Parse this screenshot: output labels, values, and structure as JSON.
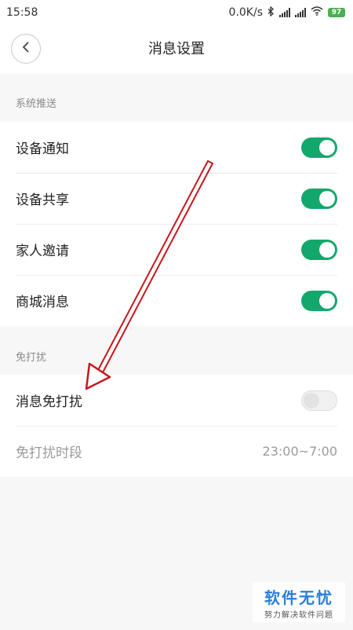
{
  "status_bar": {
    "time": "15:58",
    "speed": "0.0K/s",
    "battery": "97"
  },
  "header": {
    "title": "消息设置"
  },
  "sections": [
    {
      "title": "系统推送",
      "items": [
        {
          "label": "设备通知",
          "toggle": "on"
        },
        {
          "label": "设备共享",
          "toggle": "on"
        },
        {
          "label": "家人邀请",
          "toggle": "on"
        },
        {
          "label": "商城消息",
          "toggle": "on"
        }
      ]
    },
    {
      "title": "免打扰",
      "items": [
        {
          "label": "消息免打扰",
          "toggle": "off"
        },
        {
          "label": "免打扰时段",
          "value": "23:00~7:00"
        }
      ]
    }
  ],
  "colors": {
    "toggle_on": "#13a86b",
    "annotation_arrow": "#c8161d"
  },
  "watermark": {
    "main": "软件无忧",
    "sub": "努力解决软件问题"
  }
}
